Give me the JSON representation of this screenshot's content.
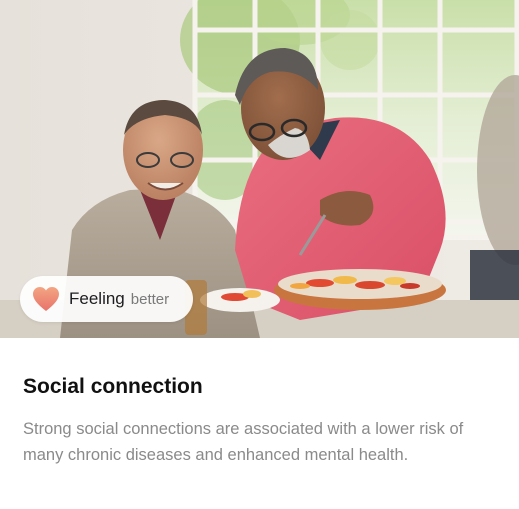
{
  "card": {
    "badge": {
      "icon": "heart-icon",
      "label": "Feeling",
      "sublabel": "better"
    },
    "title": "Social connection",
    "description": "Strong social connections are associated with a lower risk of many chronic diseases and enhanced mental health."
  },
  "colors": {
    "title_text": "#111111",
    "description_text": "#8a8a8a",
    "heart_top": "#f3a583",
    "heart_bottom": "#e8736b",
    "sweater_pink": "#e45f73"
  }
}
